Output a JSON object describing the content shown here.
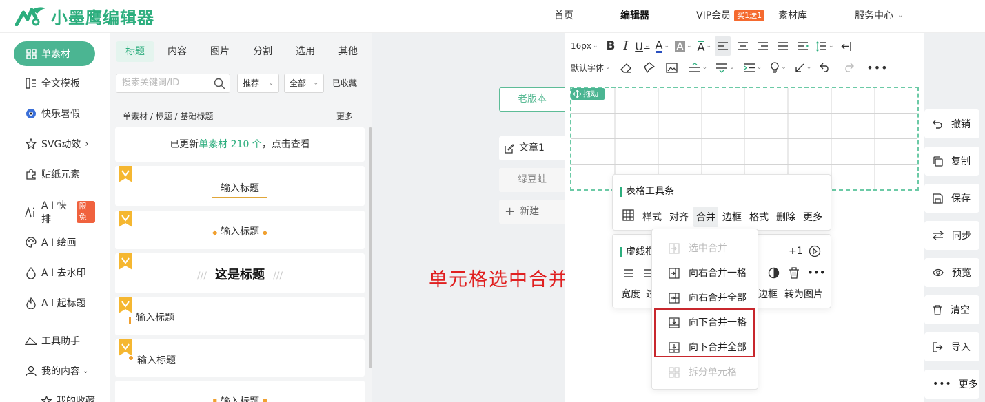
{
  "header": {
    "logo_text": "小墨鹰编辑器",
    "nav": [
      {
        "label": "首页"
      },
      {
        "label": "编辑器",
        "active": true
      },
      {
        "label": "VIP会员",
        "badge": "买1送1"
      },
      {
        "label": "素材库"
      },
      {
        "label": "服务中心"
      }
    ]
  },
  "sidebar": {
    "items": [
      {
        "label": "单素材",
        "icon": "grid-icon",
        "active": true
      },
      {
        "label": "全文模板",
        "icon": "template-icon"
      },
      {
        "label": "快乐暑假",
        "icon": "soccer-ball-icon"
      },
      {
        "label": "SVG动效",
        "icon": "star-icon"
      },
      {
        "label": "贴纸元素",
        "icon": "puzzle-icon"
      },
      {
        "label": "A I 快排",
        "icon": "ai-layout-icon",
        "badge": "限免"
      },
      {
        "label": "A I 绘画",
        "icon": "palette-icon"
      },
      {
        "label": "A I 去水印",
        "icon": "drop-icon"
      },
      {
        "label": "A I 起标题",
        "icon": "flame-icon"
      },
      {
        "label": "工具助手",
        "icon": "ruler-icon"
      },
      {
        "label": "我的内容",
        "icon": "user-icon"
      },
      {
        "label": "我的收藏",
        "icon": "star-outline-icon"
      }
    ]
  },
  "material_panel": {
    "tabs": [
      "标题",
      "内容",
      "图片",
      "分割",
      "选用",
      "其他"
    ],
    "active_tab": "标题",
    "search_placeholder": "搜索关键词/ID",
    "sort_select": "推荐",
    "filter_select": "全部",
    "favorites_label": "已收藏",
    "breadcrumb": "单素材 / 标题 / 基础标题",
    "more_label": "更多",
    "update_notice": {
      "prefix": "已更新",
      "highlight": "单素材 210 个",
      "suffix": "，点击查看"
    },
    "cards": [
      "输入标题",
      "输入标题",
      "这是标题",
      "输入标题",
      "输入标题",
      "输入标题"
    ]
  },
  "canvas": {
    "old_version_label": "老版本",
    "docs": [
      "文章1",
      "绿豆蛙"
    ],
    "new_label": "新建",
    "annotation": "单元格选中合并"
  },
  "editor": {
    "font_size": "16px",
    "font_family": "默认字体",
    "drag_label": "拖动",
    "table_toolbar": {
      "title": "表格工具条",
      "tools": [
        "样式",
        "对齐",
        "合并",
        "边框",
        "格式",
        "删除",
        "更多"
      ],
      "active_tool": "合并"
    },
    "dashed_popup": {
      "title": "虚线框",
      "counter": "+1",
      "row2": [
        "宽度",
        "边框",
        "转为图片"
      ]
    },
    "merge_menu": [
      {
        "label": "选中合并",
        "disabled": true
      },
      {
        "label": "向右合并一格"
      },
      {
        "label": "向右合并全部"
      },
      {
        "label": "向下合并一格",
        "highlighted": true
      },
      {
        "label": "向下合并全部",
        "highlighted": true
      },
      {
        "label": "拆分单元格",
        "disabled": true
      }
    ]
  },
  "right_actions": [
    "撤销",
    "复制",
    "保存",
    "同步",
    "预览",
    "清空",
    "导入",
    "更多"
  ],
  "colors": {
    "brand": "#2dae7e",
    "annotation_red": "#e02020",
    "highlight_border": "#c8272d",
    "vip_badge": "#f56a2f"
  }
}
